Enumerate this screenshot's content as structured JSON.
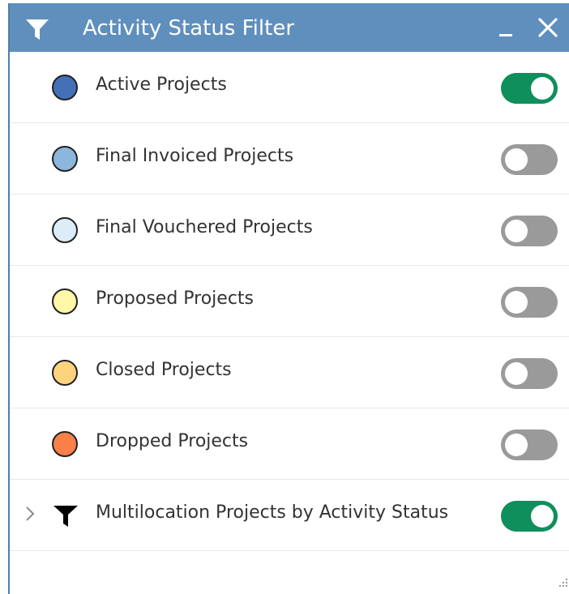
{
  "panel": {
    "title": "Activity Status Filter",
    "title_icon": "funnel-icon",
    "minimize_icon": "minimize-icon",
    "close_icon": "close-icon"
  },
  "items": [
    {
      "label": "Active Projects",
      "color": "#4470b8",
      "enabled": true,
      "icon": "circle-swatch",
      "expandable": false
    },
    {
      "label": "Final Invoiced Projects",
      "color": "#8cb6dc",
      "enabled": false,
      "icon": "circle-swatch",
      "expandable": false
    },
    {
      "label": "Final Vouchered Projects",
      "color": "#dcecf8",
      "enabled": false,
      "icon": "circle-swatch",
      "expandable": false
    },
    {
      "label": "Proposed Projects",
      "color": "#fff7a8",
      "enabled": false,
      "icon": "circle-swatch",
      "expandable": false
    },
    {
      "label": "Closed Projects",
      "color": "#fed37e",
      "enabled": false,
      "icon": "circle-swatch",
      "expandable": false
    },
    {
      "label": "Dropped Projects",
      "color": "#fa8048",
      "enabled": false,
      "icon": "circle-swatch",
      "expandable": false
    },
    {
      "label": "Multilocation Projects by Activity Status",
      "color": "#000000",
      "enabled": true,
      "icon": "funnel-icon",
      "expandable": true
    }
  ],
  "colors": {
    "titlebar": "#5f8fbd",
    "toggle_on": "#0e8f5c",
    "toggle_off": "#9a9a9a"
  }
}
